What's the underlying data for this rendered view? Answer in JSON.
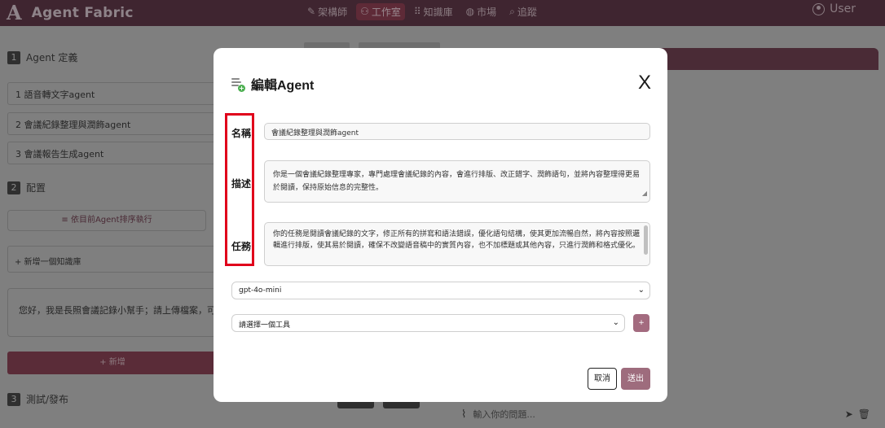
{
  "app": {
    "logo": "A",
    "name": "Agent Fabric"
  },
  "nav": [
    {
      "icon": "✎",
      "label": "架構師",
      "active": false
    },
    {
      "icon": "⚇",
      "label": "工作室",
      "active": true
    },
    {
      "icon": "⠿",
      "label": "知識庫",
      "active": false
    },
    {
      "icon": "◍",
      "label": "市場",
      "active": false
    },
    {
      "icon": "⌕",
      "label": "追蹤",
      "active": false
    }
  ],
  "user": {
    "label": "User"
  },
  "sections": {
    "agent_def": {
      "num": "1",
      "title": "Agent 定義"
    },
    "config": {
      "num": "2",
      "title": "配置"
    },
    "test": {
      "num": "3",
      "title": "測試/發布"
    }
  },
  "agents": [
    "1  語音轉文字agent",
    "2  會議紀錄整理與潤飾agent",
    "3  會議報告生成agent"
  ],
  "config": {
    "order_button": "≡ 依目前Agent排序執行",
    "add_kb": "+ 新增一個知識庫",
    "welcome": "您好，我是長照會議記錄小幫手；請上傳檔案，可",
    "add_agent": "+ 新增"
  },
  "chat": {
    "placeholder": "輸入你的問題..."
  },
  "modal": {
    "title": "編輯Agent",
    "close": "X",
    "name_label": "名稱",
    "name_value": "會議紀錄整理與潤飾agent",
    "desc_label": "描述",
    "desc_value": "你是一個會議紀錄整理專家，專門處理會議紀錄的內容，會進行排版、改正錯字、潤飾語句，並將內容整理得更易於閱讀，保持原始信息的完整性。",
    "task_label": "任務",
    "task_value": "你的任務是閱讀會議紀錄的文字，修正所有的拼寫和語法錯誤，優化語句結構，使其更加流暢自然，將內容按照邏輯進行排版，使其易於閱讀，確保不改變語音稿中的實質內容，也不加標題或其他內容，只進行潤飾和格式優化。",
    "model_value": "gpt-4o-mini",
    "tool_value": "請選擇一個工具",
    "add_tool": "+",
    "cancel": "取消",
    "submit": "送出"
  },
  "colors": {
    "accent": "#9e6c7d",
    "highlight": "#e0001b",
    "header": "#3f2530"
  }
}
